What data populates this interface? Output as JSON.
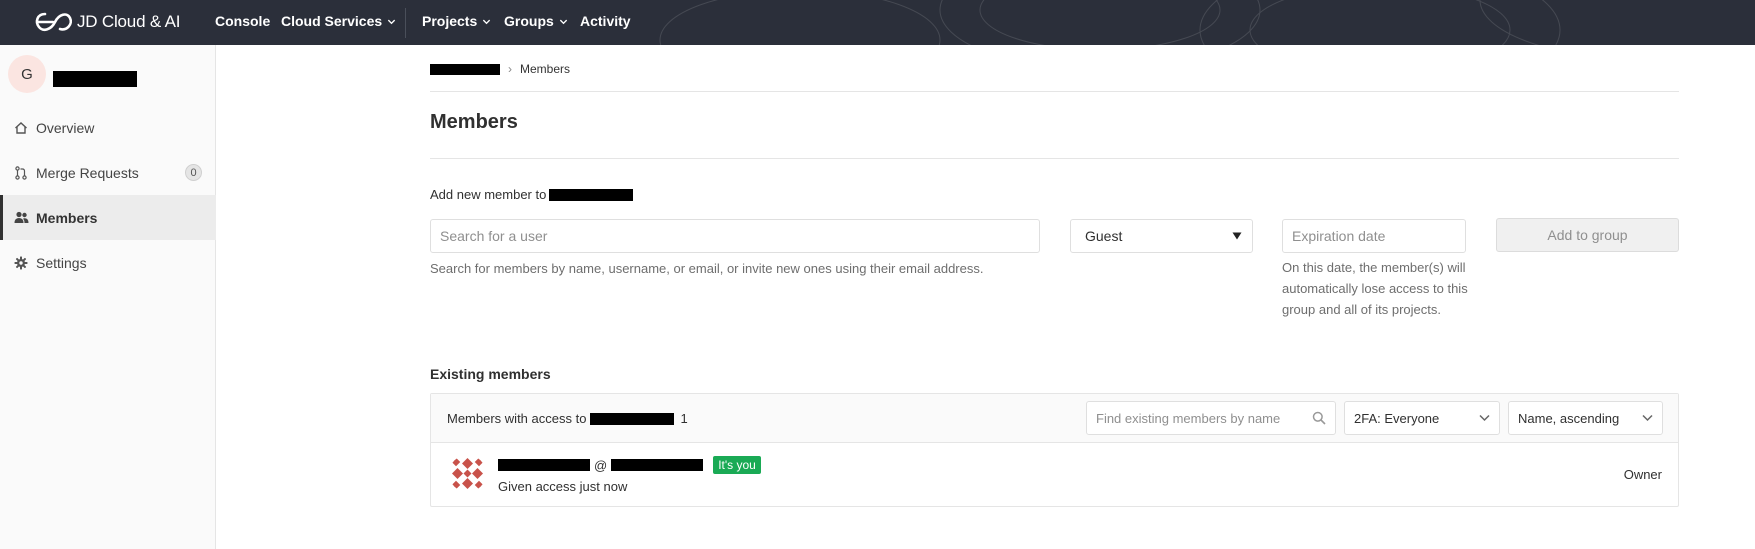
{
  "header": {
    "logo_text": "JD Cloud & AI",
    "nav": {
      "console": "Console",
      "cloud_services": "Cloud Services",
      "projects": "Projects",
      "groups": "Groups",
      "activity": "Activity"
    }
  },
  "sidebar": {
    "group_initial": "G",
    "items": [
      {
        "label": "Overview",
        "icon": "home-icon"
      },
      {
        "label": "Merge Requests",
        "icon": "merge-request-icon",
        "badge": "0"
      },
      {
        "label": "Members",
        "icon": "users-icon"
      },
      {
        "label": "Settings",
        "icon": "gear-icon"
      }
    ]
  },
  "breadcrumb": {
    "separator": "›",
    "current": "Members"
  },
  "page_title": "Members",
  "add_member": {
    "label": "Add new member to",
    "search_placeholder": "Search for a user",
    "search_help": "Search for members by name, username, or email, or invite new ones using their email address.",
    "role_value": "Guest",
    "expiration_placeholder": "Expiration date",
    "expiration_help": "On this date, the member(s) will automatically lose access to this group and all of its projects.",
    "add_button": "Add to group"
  },
  "existing": {
    "title": "Existing members",
    "access_label": "Members with access to",
    "count": "1",
    "find_placeholder": "Find existing members by name",
    "twofa_value": "2FA: Everyone",
    "sort_value": "Name, ascending",
    "members": [
      {
        "at": "@",
        "badge": "It's you",
        "meta": "Given access just now",
        "role": "Owner"
      }
    ]
  },
  "colors": {
    "topbar": "#2b2f3a",
    "you_badge": "#1aaa55"
  }
}
